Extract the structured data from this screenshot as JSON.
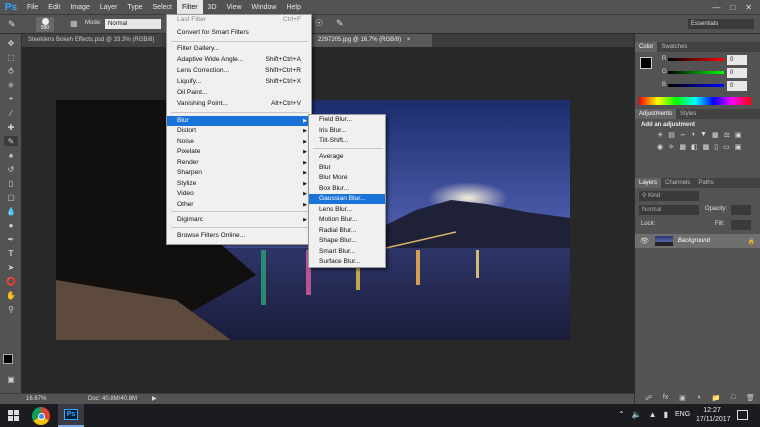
{
  "app": {
    "logo": "Ps"
  },
  "menubar": {
    "items": [
      "File",
      "Edit",
      "Image",
      "Layer",
      "Type",
      "Select",
      "Filter",
      "3D",
      "View",
      "Window",
      "Help"
    ],
    "active": "Filter"
  },
  "options_bar": {
    "brush_size": "990",
    "mode_label": "Mode:",
    "mode_value": "Normal",
    "workspace": "Essentials"
  },
  "doc_tabs": [
    {
      "title": "Steeklens Bokeh Effects.psd @ 33.3% (RGB/8)"
    },
    {
      "title": "2297205.jpg @ 16.7% (RGB/8)"
    }
  ],
  "status": {
    "zoom": "16.67%",
    "doc": "Doc: 40.8M/40.8M"
  },
  "filter_menu": {
    "items": [
      {
        "label": "Last Filter",
        "shortcut": "Ctrl+F",
        "disabled": true
      },
      {
        "label": "Convert for Smart Filters"
      },
      {
        "label": "Filter Gallery..."
      },
      {
        "label": "Adaptive Wide Angle...",
        "shortcut": "Shift+Ctrl+A"
      },
      {
        "label": "Lens Correction...",
        "shortcut": "Shift+Ctrl+R"
      },
      {
        "label": "Liquify...",
        "shortcut": "Shift+Ctrl+X"
      },
      {
        "label": "Oil Paint..."
      },
      {
        "label": "Vanishing Point...",
        "shortcut": "Alt+Ctrl+V"
      },
      {
        "label": "Blur",
        "submenu": true,
        "highlighted": true
      },
      {
        "label": "Distort",
        "submenu": true
      },
      {
        "label": "Noise",
        "submenu": true
      },
      {
        "label": "Pixelate",
        "submenu": true
      },
      {
        "label": "Render",
        "submenu": true
      },
      {
        "label": "Sharpen",
        "submenu": true
      },
      {
        "label": "Stylize",
        "submenu": true
      },
      {
        "label": "Video",
        "submenu": true
      },
      {
        "label": "Other",
        "submenu": true
      },
      {
        "label": "Digimarc",
        "submenu": true
      },
      {
        "label": "Browse Filters Online..."
      }
    ]
  },
  "blur_submenu": {
    "items": [
      {
        "label": "Field Blur..."
      },
      {
        "label": "Iris Blur..."
      },
      {
        "label": "Tilt-Shift..."
      },
      {
        "label": "Average"
      },
      {
        "label": "Blur"
      },
      {
        "label": "Blur More"
      },
      {
        "label": "Box Blur..."
      },
      {
        "label": "Gaussian Blur...",
        "highlighted": true
      },
      {
        "label": "Lens Blur..."
      },
      {
        "label": "Motion Blur..."
      },
      {
        "label": "Radial Blur..."
      },
      {
        "label": "Shape Blur..."
      },
      {
        "label": "Smart Blur..."
      },
      {
        "label": "Surface Blur..."
      }
    ]
  },
  "color_panel": {
    "tabs": [
      "Color",
      "Swatches"
    ],
    "r_label": "R",
    "r_value": "0",
    "g_label": "G",
    "g_value": "0",
    "b_label": "B",
    "b_value": "0"
  },
  "adjustments_panel": {
    "tabs": [
      "Adjustments",
      "Styles"
    ],
    "heading": "Add an adjustment"
  },
  "layers_panel": {
    "tabs": [
      "Layers",
      "Channels",
      "Paths"
    ],
    "kind": "Kind",
    "blend": "Normal",
    "opacity_label": "Opacity:",
    "lock_label": "Lock:",
    "fill_label": "Fill:",
    "layer_name": "Background"
  },
  "taskbar": {
    "time": "12:27",
    "date": "17/11/2017",
    "lang": "ENG"
  },
  "colors": {
    "accent": "#1a73d6",
    "ui_dark": "#535353",
    "canvas": "#282828"
  }
}
